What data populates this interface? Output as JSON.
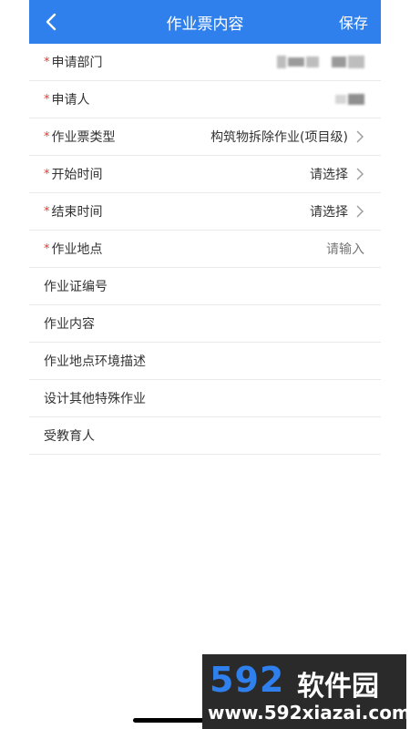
{
  "header": {
    "title": "作业票内容",
    "save_label": "保存",
    "back_icon": "chevron-left-icon",
    "background": "#2f80ed"
  },
  "form": {
    "rows": [
      {
        "label": "申请部门",
        "required": true,
        "value": "",
        "value_kind": "redacted"
      },
      {
        "label": "申请人",
        "required": true,
        "value": "",
        "value_kind": "redacted"
      },
      {
        "label": "作业票类型",
        "required": true,
        "value": "构筑物拆除作业(项目级)",
        "value_kind": "select"
      },
      {
        "label": "开始时间",
        "required": true,
        "value": "请选择",
        "value_kind": "select"
      },
      {
        "label": "结束时间",
        "required": true,
        "value": "请选择",
        "value_kind": "select"
      },
      {
        "label": "作业地点",
        "required": true,
        "value": "请输入",
        "value_kind": "input"
      },
      {
        "label": "作业证编号",
        "required": false,
        "value": "",
        "value_kind": "none"
      },
      {
        "label": "作业内容",
        "required": false,
        "value": "",
        "value_kind": "none"
      },
      {
        "label": "作业地点环境描述",
        "required": false,
        "value": "",
        "value_kind": "none"
      },
      {
        "label": "设计其他特殊作业",
        "required": false,
        "value": "",
        "value_kind": "none"
      },
      {
        "label": "受教育人",
        "required": false,
        "value": "",
        "value_kind": "none"
      }
    ]
  },
  "watermark": {
    "brand": "592",
    "name": "软件园",
    "url": "www.592xiazai.com"
  },
  "colors": {
    "accent": "#2f80ed",
    "required": "#e23a2f",
    "divider": "#e9e9e9"
  }
}
